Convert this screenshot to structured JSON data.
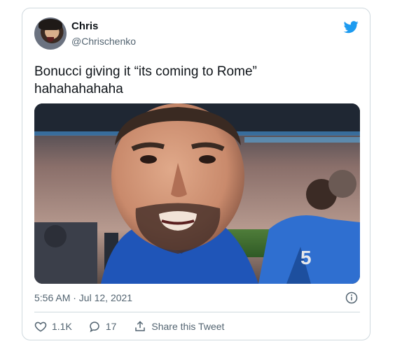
{
  "tweet": {
    "author_name": "Chris",
    "author_handle": "@Chrischenko",
    "text_line1": "Bonucci giving it “its coming to Rome”",
    "text_line2": "hahahahahaha",
    "timestamp": "5:56 AM · Jul 12, 2021",
    "likes": "1.1K",
    "replies": "17",
    "share_label": "Share this Tweet"
  },
  "icons": {
    "brand": "twitter-bird-icon",
    "info": "info-icon",
    "like": "heart-icon",
    "reply": "reply-bubble-icon",
    "share": "share-icon"
  },
  "colors": {
    "brand_blue": "#1d9bf0",
    "secondary_text": "#536471",
    "border": "#cfd9de"
  }
}
